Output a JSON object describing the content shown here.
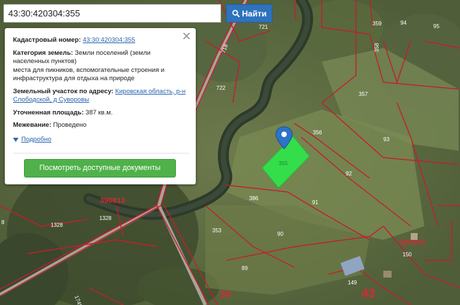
{
  "search": {
    "value": "43:30:420304:355",
    "button_label": "Найти"
  },
  "popup": {
    "cad_number_label": "Кадастровый номер:",
    "cad_number_value": "43:30:420304:355",
    "category_label": "Категория земель:",
    "category_value_1": "Земли поселений (земли",
    "category_value_2": "населенных пунктов)",
    "use_line_1": "места для пикников, вспомогательные строения и",
    "use_line_2": "инфраструктура для отдыха на природе",
    "address_label": "Земельный участок по адресу:",
    "address_link_1": "Кировская область, р-н",
    "address_link_2": "Слободской, д Суворовы",
    "area_label": "Уточненная площадь:",
    "area_value": "387 кв.м.",
    "survey_label": "Межевание:",
    "survey_value": "Проведено",
    "details_label": "Подробно",
    "docs_button": "Посмотреть доступные документы"
  },
  "map": {
    "parcels": [
      {
        "id": "p721",
        "label": "721"
      },
      {
        "id": "p718",
        "label": "718"
      },
      {
        "id": "p722",
        "label": "722"
      },
      {
        "id": "p359",
        "label": "359"
      },
      {
        "id": "p94",
        "label": "94"
      },
      {
        "id": "p358",
        "label": "358"
      },
      {
        "id": "p95",
        "label": "95"
      },
      {
        "id": "p357",
        "label": "357"
      },
      {
        "id": "p356",
        "label": "356"
      },
      {
        "id": "p93",
        "label": "93"
      },
      {
        "id": "p355",
        "label": "355"
      },
      {
        "id": "p92",
        "label": "92"
      },
      {
        "id": "p386",
        "label": "386"
      },
      {
        "id": "p91",
        "label": "91"
      },
      {
        "id": "p353",
        "label": "353"
      },
      {
        "id": "p90",
        "label": "90"
      },
      {
        "id": "p89",
        "label": "89"
      },
      {
        "id": "p149",
        "label": "149"
      },
      {
        "id": "p150",
        "label": "150"
      },
      {
        "id": "p1328a",
        "label": "1328"
      },
      {
        "id": "p1328b",
        "label": "1328"
      },
      {
        "id": "p1745",
        "label": "1745"
      },
      {
        "id": "p8",
        "label": "8"
      }
    ],
    "quarters": [
      {
        "id": "q390813",
        "label": "390813"
      },
      {
        "id": "q420304",
        "label": "420304"
      },
      {
        "id": "q30",
        "label": "30"
      },
      {
        "id": "q43",
        "label": "43"
      }
    ],
    "colors": {
      "boundary": "#c21f2e",
      "selected": "#2ee84a",
      "pin": "#2d73c9"
    }
  }
}
